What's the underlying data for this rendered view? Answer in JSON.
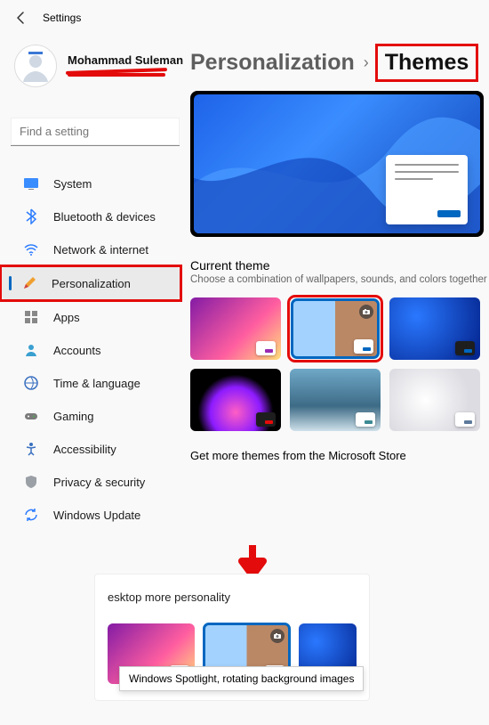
{
  "window": {
    "title": "Settings"
  },
  "user": {
    "name": "Mohammad Suleman"
  },
  "breadcrumb": {
    "parent": "Personalization",
    "current": "Themes"
  },
  "search": {
    "placeholder": "Find a setting"
  },
  "nav": {
    "items": [
      {
        "label": "System"
      },
      {
        "label": "Bluetooth & devices"
      },
      {
        "label": "Network & internet"
      },
      {
        "label": "Personalization"
      },
      {
        "label": "Apps"
      },
      {
        "label": "Accounts"
      },
      {
        "label": "Time & language"
      },
      {
        "label": "Gaming"
      },
      {
        "label": "Accessibility"
      },
      {
        "label": "Privacy & security"
      },
      {
        "label": "Windows Update"
      }
    ]
  },
  "section": {
    "title": "Current theme",
    "subtitle": "Choose a combination of wallpapers, sounds, and colors together",
    "more": "Get more themes from the Microsoft Store"
  },
  "bottom": {
    "fragment": "esktop more personality",
    "tooltip": "Windows Spotlight, rotating background images"
  }
}
